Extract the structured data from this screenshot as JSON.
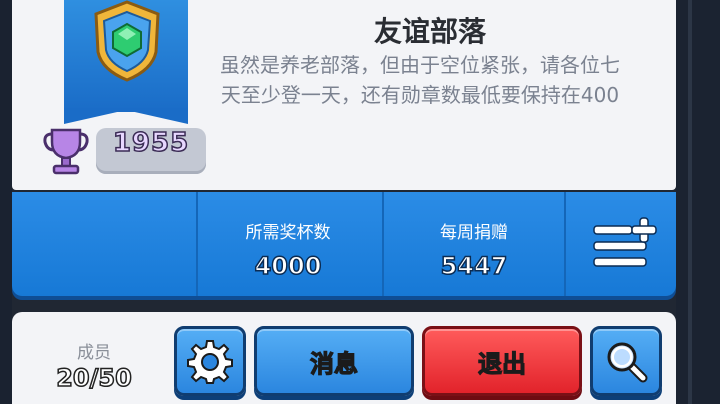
{
  "clan": {
    "name": "友谊部落",
    "description": "虽然是养老部落，但由于空位紧张，请各位七天至少登一天，还有勋章数最低要保持在400",
    "trophies": "1955"
  },
  "stats": [
    {
      "label": "所需奖杯数",
      "value": "4000"
    },
    {
      "label": "每周捐赠",
      "value": "5447"
    }
  ],
  "members": {
    "label": "成员",
    "value": "20/50"
  },
  "buttons": {
    "settings_icon": "gear-icon",
    "messages_label": "消息",
    "leave_label": "退出",
    "search_icon": "magnifier-icon"
  },
  "colors": {
    "panel_blue": "#2b8ce6",
    "leave_red": "#e2232b",
    "badge_gem": "#2ecc71",
    "trophy_purple": "#b785e6"
  }
}
